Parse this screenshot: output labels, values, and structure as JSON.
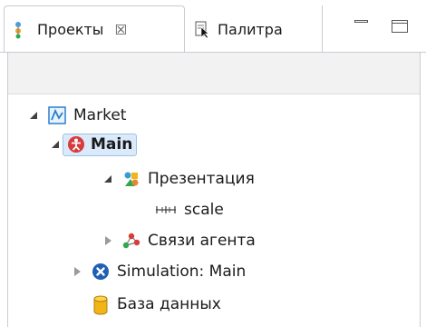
{
  "tabs": [
    {
      "label": "Проекты",
      "close": "☒",
      "icon": "projects-icon"
    },
    {
      "label": "Палитра",
      "icon": "palette-icon"
    }
  ],
  "window_controls": [
    "minimize-icon",
    "maximize-icon"
  ],
  "tree": {
    "items": [
      {
        "label": "Market",
        "icon": "model-icon",
        "state": "expanded"
      },
      {
        "label": "Main",
        "icon": "agent-icon",
        "state": "expanded",
        "selected": true
      },
      {
        "label": "Презентация",
        "icon": "presentation-icon",
        "state": "expanded"
      },
      {
        "label": "scale",
        "icon": "scale-icon",
        "state": "leaf"
      },
      {
        "label": "Связи агента",
        "icon": "agent-links-icon",
        "state": "collapsed"
      },
      {
        "label": "Simulation: Main",
        "icon": "simulation-icon",
        "state": "collapsed"
      },
      {
        "label": "База данных",
        "icon": "database-icon",
        "state": "leaf"
      }
    ]
  },
  "colors": {
    "selection_bg": "#dbeafa",
    "selection_border": "#9cc3e6",
    "agent_red": "#d83b3b",
    "simulation_blue": "#1f5fb5",
    "database_yellow": "#f2b516"
  }
}
